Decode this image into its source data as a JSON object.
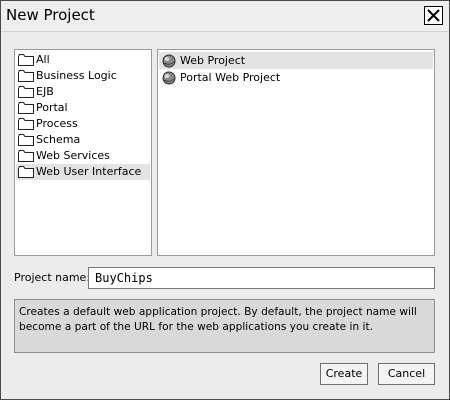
{
  "window": {
    "title": "New Project",
    "close_icon": "close-x-icon"
  },
  "categories": {
    "items": [
      {
        "label": "All",
        "icon": "folder-icon"
      },
      {
        "label": "Business Logic",
        "icon": "folder-icon"
      },
      {
        "label": "EJB",
        "icon": "folder-icon"
      },
      {
        "label": "Portal",
        "icon": "folder-icon"
      },
      {
        "label": "Process",
        "icon": "folder-icon"
      },
      {
        "label": "Schema",
        "icon": "folder-icon"
      },
      {
        "label": "Web Services",
        "icon": "folder-icon"
      },
      {
        "label": "Web User Interface",
        "icon": "folder-icon",
        "selected": true
      }
    ]
  },
  "templates": {
    "items": [
      {
        "label": "Web Project",
        "icon": "globe-icon",
        "selected": true
      },
      {
        "label": "Portal Web Project",
        "icon": "globe-icon"
      }
    ]
  },
  "project_name": {
    "label": "Project name:",
    "value": "BuyChips"
  },
  "description": {
    "text": "Creates a default web application project. By default, the project name will become a part of the URL for the web applications you create in it."
  },
  "buttons": {
    "create_label": "Create",
    "cancel_label": "Cancel"
  },
  "colors": {
    "selection": "#e3e3e3",
    "window_bg": "#ececec",
    "description_bg": "#d9d9d9"
  }
}
